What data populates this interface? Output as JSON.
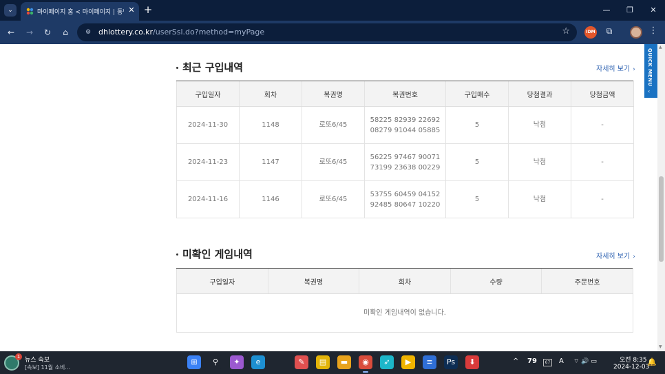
{
  "browser": {
    "tab_title": "마이페이지 홈 < 마이페이지 | 동행",
    "url_host": "dhlottery.co.kr",
    "url_path": "/userSsl.do?method=myPage",
    "tab_menu_icon": "chevron-down-icon",
    "new_tab_icon": "plus-icon",
    "extension_badge": "IDM",
    "icons": {
      "back": "←",
      "forward": "→",
      "reload": "↻",
      "home": "⌂",
      "site_info": "⚙",
      "star": "☆",
      "puzzle": "⧉",
      "menu": "⋮",
      "tab_close": "✕",
      "new_tab": "+",
      "minimize": "—",
      "maximize": "❐",
      "close": "✕"
    }
  },
  "recent": {
    "title": "최근 구입내역",
    "more_label": "자세히 보기",
    "more_icon": "›",
    "headers": [
      "구입일자",
      "회차",
      "복권명",
      "복권번호",
      "구입매수",
      "당첨결과",
      "당첨금액"
    ],
    "rows": [
      {
        "date": "2024-11-30",
        "round": "1148",
        "name": "로또6/45",
        "numbers1": "58225 82939 22692",
        "numbers2": "08279 91044 05885",
        "qty": "5",
        "result": "낙첨",
        "prize": "-"
      },
      {
        "date": "2024-11-23",
        "round": "1147",
        "name": "로또6/45",
        "numbers1": "56225 97467 90071",
        "numbers2": "73199 23638 00229",
        "qty": "5",
        "result": "낙첨",
        "prize": "-"
      },
      {
        "date": "2024-11-16",
        "round": "1146",
        "name": "로또6/45",
        "numbers1": "53755 60459 04152",
        "numbers2": "92485 80647 10220",
        "qty": "5",
        "result": "낙첨",
        "prize": "-"
      }
    ]
  },
  "unconfirmed": {
    "title": "미확인 게임내역",
    "more_label": "자세히 보기",
    "more_icon": "›",
    "headers": [
      "구입일자",
      "복권명",
      "회차",
      "수량",
      "주문번호"
    ],
    "empty_message": "미확인 게임내역이 없습니다."
  },
  "quick_menu": {
    "label": "QUICK MENU",
    "icon": "‹"
  },
  "taskbar": {
    "news_title": "뉴스 속보",
    "news_subtitle": "[속보] 11월 소비...",
    "news_badge": "1",
    "tray_number": "79",
    "tray_small": "67",
    "tray_ime": "A",
    "tray_arrow": "^",
    "tray_icons": "⌔ 🔊 ▭",
    "clock_time": "오전 8:35",
    "clock_date": "2024-12-03",
    "apps": [
      {
        "name": "windows-start-icon",
        "glyph": "⊞",
        "color": "#3b82f6"
      },
      {
        "name": "search-icon",
        "glyph": "⚲",
        "color": "#1f2630"
      },
      {
        "name": "copilot-icon",
        "glyph": "✦",
        "color": "#9b59d0"
      },
      {
        "name": "edge-icon",
        "glyph": "e",
        "color": "#1d8fd1"
      },
      {
        "name": "app-cursor-icon",
        "glyph": "✎",
        "color": "#e05050"
      },
      {
        "name": "sticky-notes-icon",
        "glyph": "▤",
        "color": "#e3b409"
      },
      {
        "name": "file-explorer-icon",
        "glyph": "▬",
        "color": "#e8a31c"
      },
      {
        "name": "chrome-icon",
        "glyph": "◉",
        "color": "#d94c3c"
      },
      {
        "name": "bird-app-icon",
        "glyph": "➶",
        "color": "#1cb6c9"
      },
      {
        "name": "media-player-icon",
        "glyph": "▶",
        "color": "#f0b400"
      },
      {
        "name": "notepad-icon",
        "glyph": "≡",
        "color": "#2f6fd6"
      },
      {
        "name": "photoshop-icon",
        "glyph": "Ps",
        "color": "#0d2d53"
      },
      {
        "name": "mediaget-icon",
        "glyph": "⬇",
        "color": "#d93b3b"
      }
    ]
  }
}
